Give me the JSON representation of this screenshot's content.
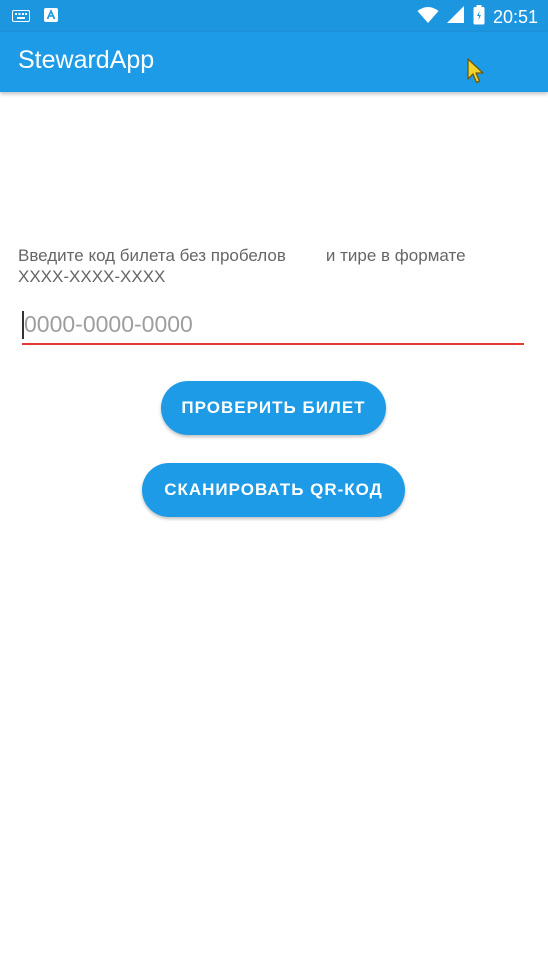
{
  "status_bar": {
    "time": "20:51",
    "icons": [
      "keyboard-icon",
      "a-icon",
      "wifi-icon",
      "signal-icon",
      "battery-icon"
    ],
    "color": "#1d96e0"
  },
  "app_bar": {
    "title": "StewardApp",
    "color": "#1d9be6"
  },
  "main": {
    "instruction_part1": "Введите код билета без пробелов",
    "instruction_part2": "и тире в формате",
    "instruction_part3": "XXXX-XXXX-XXXX",
    "ticket_input": {
      "value": "",
      "placeholder": "0000-0000-0000",
      "underline_color": "#e53935"
    },
    "check_button_label": "ПРОВЕРИТЬ БИЛЕТ",
    "scan_button_label": "СКАНИРОВАТЬ QR-КОД",
    "button_color": "#1d9be6"
  }
}
